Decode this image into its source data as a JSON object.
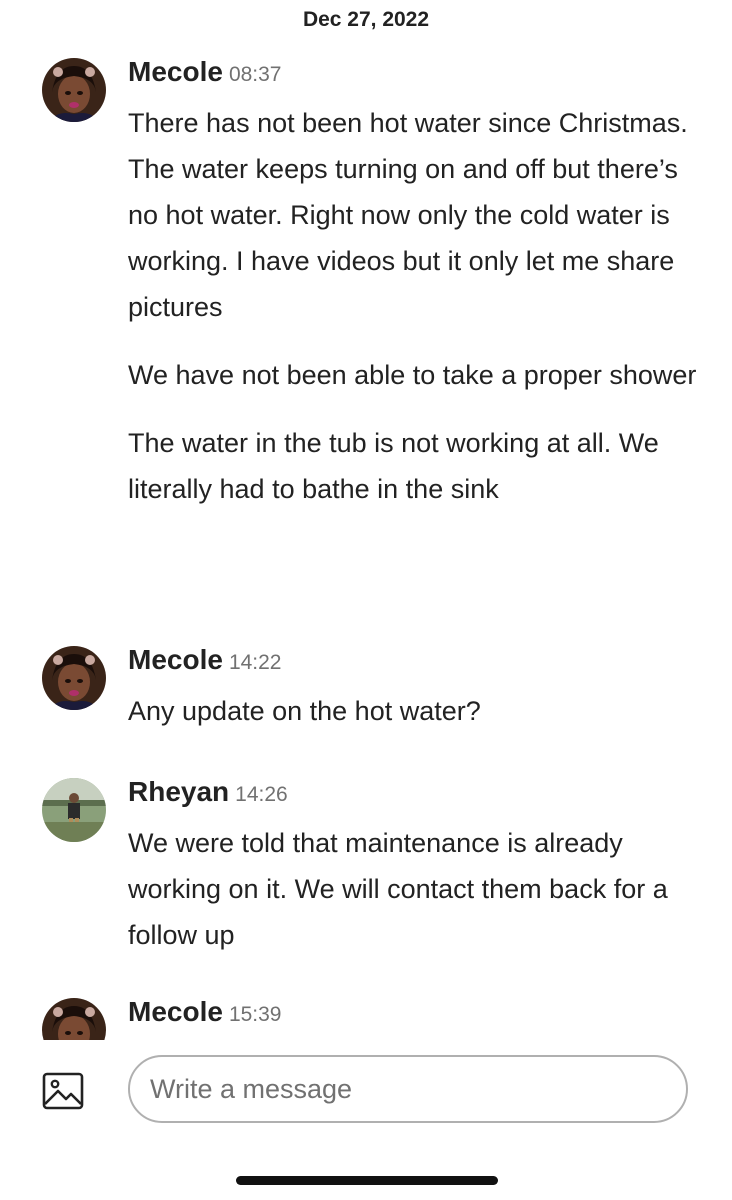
{
  "thread": {
    "date": "Dec 27, 2022",
    "messages": [
      {
        "sender": "Mecole",
        "time": "08:37",
        "avatar": "mecole-avatar",
        "paragraphs": [
          "There has not been hot water since Christmas. The water keeps turning on and off but there’s no hot water. Right now only the cold water is working. I have videos but it only let me share pictures",
          "We have not been able to take a proper shower",
          "The water in the tub is not working at all. We literally had to bathe in the sink"
        ]
      },
      {
        "sender": "Mecole",
        "time": "14:22",
        "avatar": "mecole-avatar",
        "paragraphs": [
          "Any update on the hot water?"
        ]
      },
      {
        "sender": "Rheyan",
        "time": "14:26",
        "avatar": "rheyan-avatar",
        "paragraphs": [
          "We were told that maintenance is already working on it. We will contact them back for a follow up"
        ]
      },
      {
        "sender": "Mecole",
        "time": "15:39",
        "avatar": "mecole-avatar",
        "paragraphs": []
      }
    ]
  },
  "composer": {
    "placeholder": "Write a message",
    "value": "",
    "image_icon": "image-icon"
  },
  "colors": {
    "text": "#222222",
    "muted": "#717171",
    "border": "#b0b0b0"
  }
}
